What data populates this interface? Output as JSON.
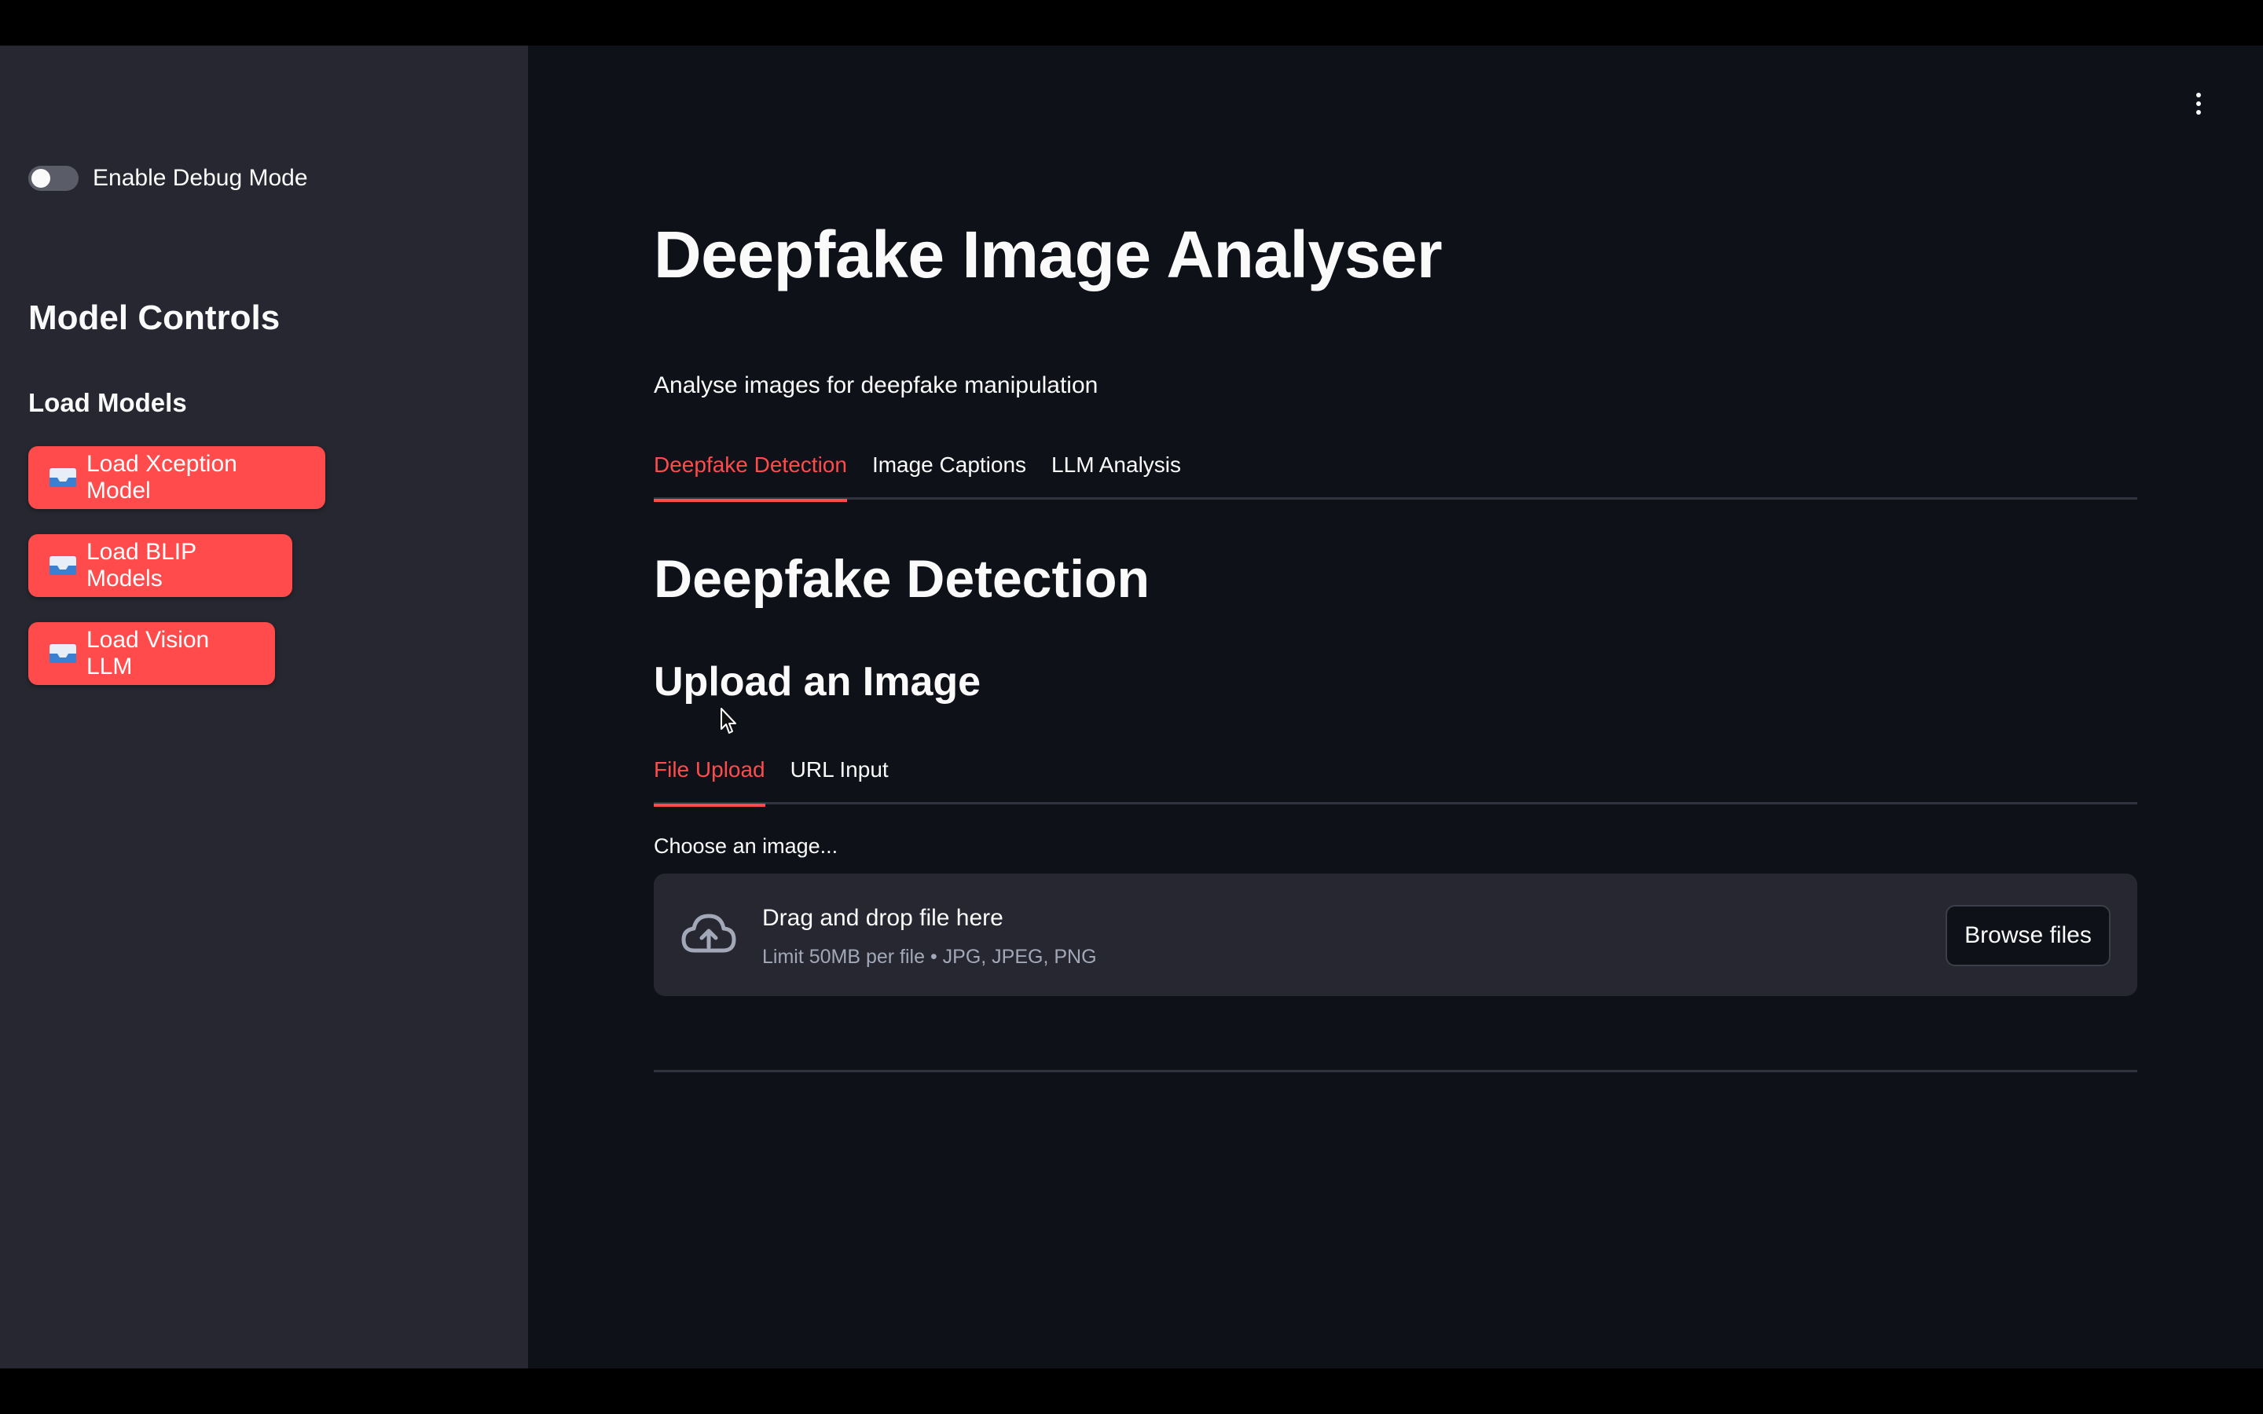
{
  "sidebar": {
    "debug_toggle_label": "Enable Debug Mode",
    "title": "Model Controls",
    "section_title": "Load Models",
    "buttons": [
      {
        "label": "Load Xception Model",
        "icon": "tray-icon"
      },
      {
        "label": "Load BLIP Models",
        "icon": "tray-icon"
      },
      {
        "label": "Load Vision LLM",
        "icon": "tray-icon"
      }
    ]
  },
  "main": {
    "title": "Deepfake Image Analyser",
    "subtitle": "Analyse images for deepfake manipulation",
    "tabs": [
      {
        "label": "Deepfake Detection",
        "active": true
      },
      {
        "label": "Image Captions",
        "active": false
      },
      {
        "label": "LLM Analysis",
        "active": false
      }
    ],
    "section_title": "Deepfake Detection",
    "upload_title": "Upload an Image",
    "upload_tabs": [
      {
        "label": "File Upload",
        "active": true
      },
      {
        "label": "URL Input",
        "active": false
      }
    ],
    "uploader": {
      "label": "Choose an image...",
      "drop_text": "Drag and drop file here",
      "limit_text": "Limit 50MB per file • JPG, JPEG, PNG",
      "browse_label": "Browse files"
    }
  },
  "colors": {
    "accent": "#ff4b4b",
    "background": "#0e1117",
    "sidebar": "#262730"
  }
}
